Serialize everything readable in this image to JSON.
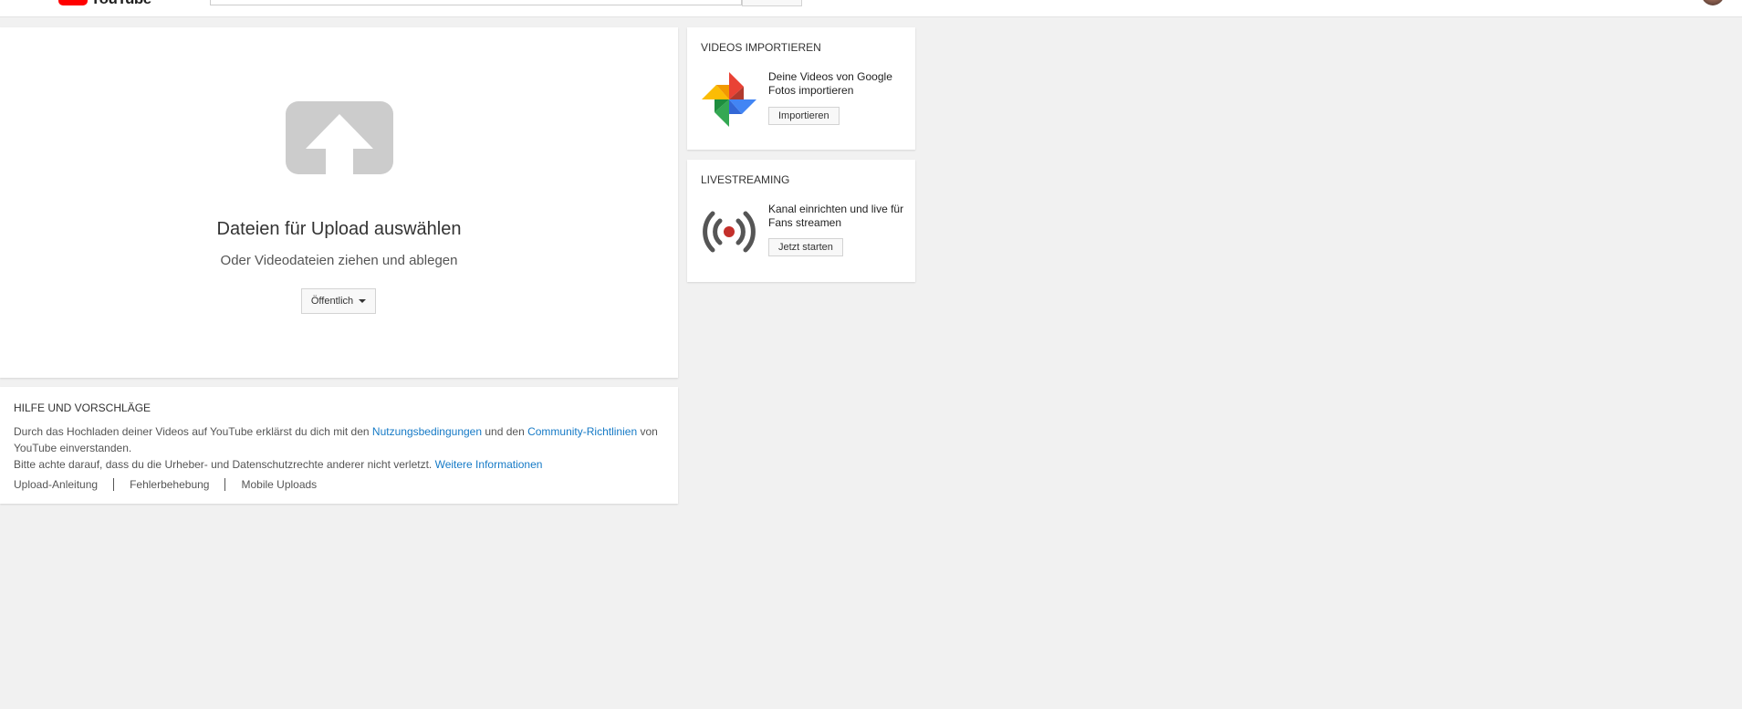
{
  "header": {
    "logo_text": "YouTube",
    "search_placeholder": ""
  },
  "upload": {
    "title": "Dateien für Upload auswählen",
    "subtitle": "Oder Videodateien ziehen und ablegen",
    "privacy_label": "Öffentlich"
  },
  "import": {
    "title": "VIDEOS IMPORTIEREN",
    "text": "Deine Videos von Google Fotos importieren",
    "button": "Importieren"
  },
  "live": {
    "title": "LIVESTREAMING",
    "text": "Kanal einrichten und live für Fans streamen",
    "button": "Jetzt starten"
  },
  "help": {
    "title": "HILFE UND VORSCHLÄGE",
    "line1_a": "Durch das Hochladen deiner Videos auf YouTube erklärst du dich mit den ",
    "terms_link": "Nutzungsbedingungen",
    "line1_b": " und den ",
    "community_link": "Community-Richtlinien",
    "line1_c": " von YouTube einverstanden.",
    "line2": "Bitte achte darauf, dass du die Urheber- und Datenschutzrechte anderer nicht verletzt. ",
    "more_link": "Weitere Informationen",
    "links": [
      "Upload-Anleitung",
      "Fehlerbehebung",
      "Mobile Uploads"
    ]
  },
  "colors": {
    "youtube_red": "#ff0000",
    "link_blue": "#167ac6",
    "upload_icon": "#cccccc",
    "live_dot": "#c4302b"
  }
}
